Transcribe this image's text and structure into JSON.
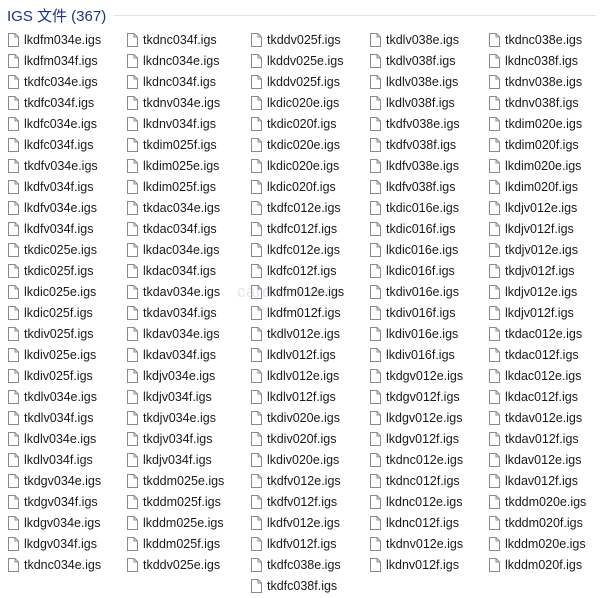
{
  "group": {
    "title": "IGS 文件 (367)"
  },
  "icon": "blank-file-icon",
  "watermark": "cardmm.com",
  "columns": [
    [
      "lkdfm034e.igs",
      "lkdfm034f.igs",
      "tkdfc034e.igs",
      "tkdfc034f.igs",
      "lkdfc034e.igs",
      "lkdfc034f.igs",
      "tkdfv034e.igs",
      "lkdfv034f.igs",
      "lkdfv034e.igs",
      "lkdfv034f.igs",
      "tkdic025e.igs",
      "tkdic025f.igs",
      "lkdic025e.igs",
      "lkdic025f.igs",
      "tkdiv025f.igs",
      "lkdiv025e.igs",
      "lkdiv025f.igs",
      "tkdlv034e.igs",
      "tkdlv034f.igs",
      "lkdlv034e.igs",
      "lkdlv034f.igs",
      "tkdgv034e.igs",
      "tkdgv034f.igs",
      "lkdgv034e.igs",
      "lkdgv034f.igs",
      "tkdnc034e.igs"
    ],
    [
      "tkdnc034f.igs",
      "lkdnc034e.igs",
      "lkdnc034f.igs",
      "tkdnv034e.igs",
      "lkdnv034f.igs",
      "tkdim025f.igs",
      "lkdim025e.igs",
      "lkdim025f.igs",
      "tkdac034e.igs",
      "tkdac034f.igs",
      "lkdac034e.igs",
      "lkdac034f.igs",
      "tkdav034e.igs",
      "tkdav034f.igs",
      "lkdav034e.igs",
      "lkdav034f.igs",
      "lkdjv034e.igs",
      "lkdjv034f.igs",
      "tkdjv034e.igs",
      "tkdjv034f.igs",
      "lkdjv034f.igs",
      "tkddm025e.igs",
      "tkddm025f.igs",
      "lkddm025e.igs",
      "lkddm025f.igs",
      "tkddv025e.igs"
    ],
    [
      "tkddv025f.igs",
      "lkddv025e.igs",
      "lkddv025f.igs",
      "lkdic020e.igs",
      "tkdic020f.igs",
      "tkdic020e.igs",
      "lkdic020e.igs",
      "lkdic020f.igs",
      "tkdfc012e.igs",
      "tkdfc012f.igs",
      "lkdfc012e.igs",
      "lkdfc012f.igs",
      "lkdfm012e.igs",
      "lkdfm012f.igs",
      "tkdlv012e.igs",
      "lkdlv012f.igs",
      "lkdlv012e.igs",
      "lkdlv012f.igs",
      "tkdiv020e.igs",
      "tkdiv020f.igs",
      "lkdiv020e.igs",
      "tkdfv012e.igs",
      "tkdfv012f.igs",
      "lkdfv012e.igs",
      "lkdfv012f.igs",
      "tkdfc038e.igs",
      "tkdfc038f.igs"
    ],
    [
      "tkdlv038e.igs",
      "tkdlv038f.igs",
      "lkdlv038e.igs",
      "lkdlv038f.igs",
      "tkdfv038e.igs",
      "tkdfv038f.igs",
      "lkdfv038e.igs",
      "lkdfv038f.igs",
      "tkdic016e.igs",
      "tkdic016f.igs",
      "lkdic016e.igs",
      "lkdic016f.igs",
      "tkdiv016e.igs",
      "tkdiv016f.igs",
      "lkdiv016e.igs",
      "lkdiv016f.igs",
      "tkdgv012e.igs",
      "tkdgv012f.igs",
      "lkdgv012e.igs",
      "lkdgv012f.igs",
      "tkdnc012e.igs",
      "tkdnc012f.igs",
      "lkdnc012e.igs",
      "lkdnc012f.igs",
      "tkdnv012e.igs",
      "lkdnv012f.igs"
    ],
    [
      "tkdnc038e.igs",
      "lkdnc038f.igs",
      "tkdnv038e.igs",
      "tkdnv038f.igs",
      "tkdim020e.igs",
      "tkdim020f.igs",
      "lkdim020e.igs",
      "lkdim020f.igs",
      "lkdjv012e.igs",
      "lkdjv012f.igs",
      "tkdjv012e.igs",
      "tkdjv012f.igs",
      "lkdjv012e.igs",
      "lkdjv012f.igs",
      "tkdac012e.igs",
      "tkdac012f.igs",
      "lkdac012e.igs",
      "lkdac012f.igs",
      "tkdav012e.igs",
      "tkdav012f.igs",
      "lkdav012e.igs",
      "lkdav012f.igs",
      "tkddm020e.igs",
      "tkddm020f.igs",
      "lkddm020e.igs",
      "lkddm020f.igs"
    ]
  ]
}
